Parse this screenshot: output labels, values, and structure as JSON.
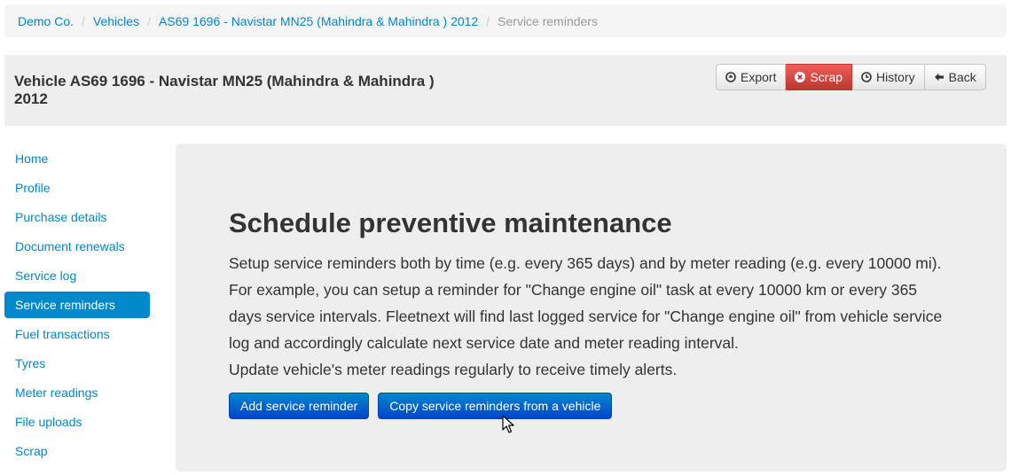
{
  "breadcrumb": {
    "items": [
      "Demo Co.",
      "Vehicles",
      "AS69 1696 - Navistar MN25 (Mahindra & Mahindra ) 2012"
    ],
    "current": "Service reminders",
    "separator": "/"
  },
  "header": {
    "title_line1": "Vehicle AS69 1696 - Navistar MN25 (Mahindra & Mahindra )",
    "title_line2": "2012",
    "actions": {
      "export": "Export",
      "scrap": "Scrap",
      "history": "History",
      "back": "Back"
    }
  },
  "sidebar": {
    "items": [
      {
        "label": "Home"
      },
      {
        "label": "Profile"
      },
      {
        "label": "Purchase details"
      },
      {
        "label": "Document renewals"
      },
      {
        "label": "Service log"
      },
      {
        "label": "Service reminders"
      },
      {
        "label": "Fuel transactions"
      },
      {
        "label": "Tyres"
      },
      {
        "label": "Meter readings"
      },
      {
        "label": "File uploads"
      },
      {
        "label": "Scrap"
      }
    ],
    "active_index": 5
  },
  "main": {
    "title": "Schedule preventive maintenance",
    "description": "Setup service reminders both by time (e.g. every 365 days) and by meter reading (e.g. every 10000 mi). For example, you can setup a reminder for \"Change engine oil\" task at every 10000 km or every 365 days service intervals. Fleetnext will find last logged service for \"Change engine oil\" from vehicle service log and accordingly calculate next service date and meter reading interval.",
    "note": "Update vehicle's meter readings regularly to receive timely alerts.",
    "add_button": "Add service reminder",
    "copy_button": "Copy service reminders from a vehicle"
  },
  "colors": {
    "link": "#0088cc",
    "primary": "#0066cc",
    "danger": "#da4f49",
    "panel": "#eeeeee"
  }
}
